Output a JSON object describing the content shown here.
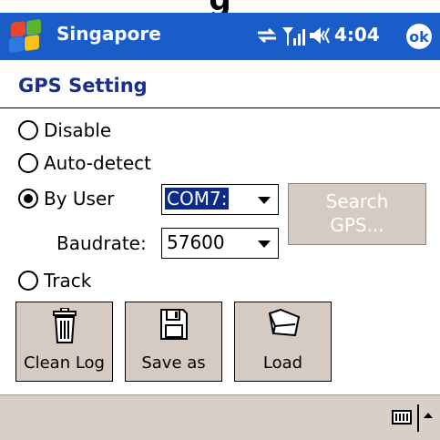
{
  "top_title_fragment": "g",
  "titlebar": {
    "app_title": "Singapore",
    "clock": "4:04",
    "ok_label": "ok",
    "icons": [
      "sync-icon",
      "signal-icon",
      "volume-icon"
    ]
  },
  "page": {
    "title": "GPS Setting"
  },
  "options": {
    "disable": "Disable",
    "auto_detect": "Auto-detect",
    "by_user": "By User",
    "track": "Track",
    "selected": "By User"
  },
  "com_port": {
    "value": "COM7:"
  },
  "baudrate": {
    "label": "Baudrate:",
    "value": "57600"
  },
  "search_gps": {
    "line1": "Search",
    "line2": "GPS...",
    "enabled": false
  },
  "toolbar": {
    "clean_log": "Clean Log",
    "save_as": "Save as",
    "load": "Load"
  },
  "colors": {
    "titlebar": "#1a5dc9",
    "page_title": "#1a2f8c",
    "button_face": "#d6cbc3",
    "selection": "#0a2b8c"
  }
}
